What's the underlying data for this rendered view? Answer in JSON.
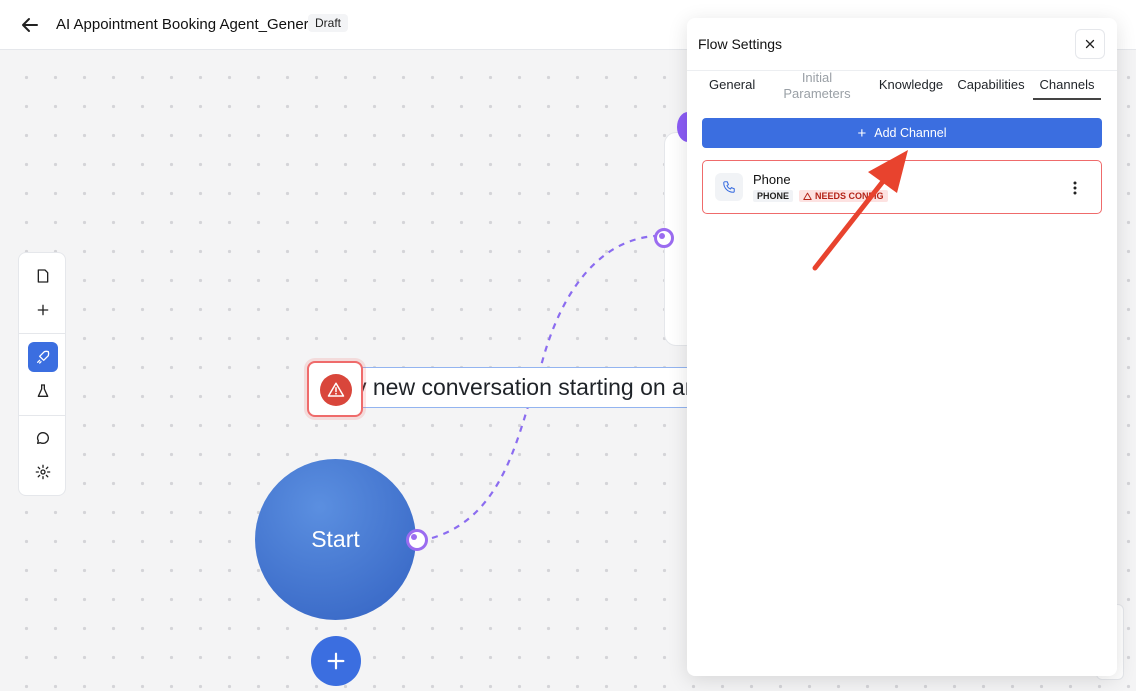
{
  "header": {
    "title": "AI Appointment Booking Agent_Generic",
    "status": "Draft"
  },
  "canvas": {
    "trigger_text": "y new conversation starting on an",
    "start_label": "Start"
  },
  "icons": {
    "back": "arrow-left-icon",
    "tools": [
      "document-icon",
      "plus-icon",
      "rocket-icon",
      "flask-icon",
      "chat-bubble-icon",
      "gear-icon"
    ],
    "warning": "warning-triangle-icon",
    "close": "close-icon",
    "phone": "phone-icon",
    "more": "more-vertical-icon"
  },
  "panel": {
    "title": "Flow Settings",
    "tabs": [
      {
        "label": "General"
      },
      {
        "label": "Initial Parameters"
      },
      {
        "label": "Knowledge"
      },
      {
        "label": "Capabilities"
      },
      {
        "label": "Channels"
      }
    ],
    "add_channel_label": "Add Channel",
    "channels": [
      {
        "name": "Phone",
        "type": "PHONE",
        "status": "NEEDS CONFIG"
      }
    ]
  },
  "colors": {
    "accent": "#3b6ee0",
    "error": "#ef6b6b",
    "port": "#9b6cf0",
    "arrow": "#e8432e"
  }
}
